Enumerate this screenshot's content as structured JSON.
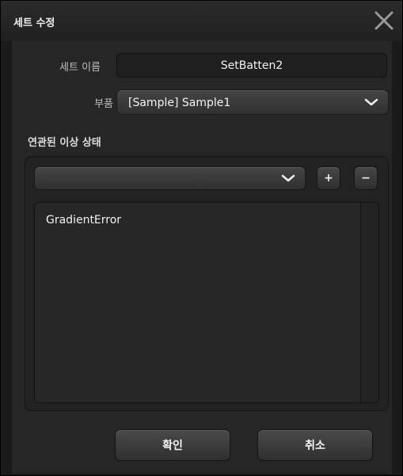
{
  "dialog": {
    "title": "세트 수정",
    "close_icon": "close-icon"
  },
  "form": {
    "set_name_label": "세트 이름",
    "set_name_value": "SetBatten2",
    "part_label": "부품",
    "part_value": "[Sample] Sample1",
    "section_title": "연관된 이상 상태"
  },
  "abnormal_states": {
    "selector_value": "",
    "add_label": "+",
    "remove_label": "−",
    "items": [
      "GradientError"
    ]
  },
  "footer": {
    "confirm_label": "확인",
    "cancel_label": "취소"
  },
  "colors": {
    "background": "#262626",
    "titlebar": "#242424",
    "button": "#3c3c3c",
    "text": "#f2f2f2"
  }
}
